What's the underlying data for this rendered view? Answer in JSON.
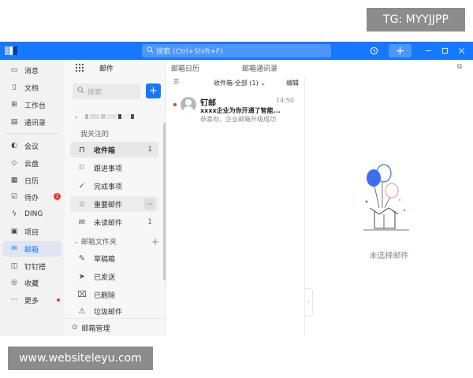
{
  "watermarks": {
    "top": "TG: MYYJJPP",
    "bottom": "www.websiteleyu.com"
  },
  "colors": {
    "accent": "#1677ff",
    "badge": "#f0353b",
    "nav_bg": "#f2f2f2",
    "active_bg": "#dfe5f2"
  },
  "titlebar": {
    "search_placeholder": "搜索 (Ctrl+Shift+F)",
    "icons": [
      "app-logo-icon",
      "search-icon",
      "history-icon",
      "plus-icon",
      "minimize-icon",
      "maximize-icon",
      "close-icon"
    ]
  },
  "nav": {
    "items": [
      {
        "label": "消息",
        "icon": "message-icon"
      },
      {
        "label": "文档",
        "icon": "document-icon"
      },
      {
        "label": "工作台",
        "icon": "workbench-icon"
      },
      {
        "label": "通讯录",
        "icon": "contacts-icon"
      },
      {
        "label": "会议",
        "icon": "meeting-icon"
      },
      {
        "label": "云盘",
        "icon": "cloud-drive-icon"
      },
      {
        "label": "日历",
        "icon": "calendar-icon"
      },
      {
        "label": "待办",
        "icon": "todo-icon",
        "badge": "1"
      },
      {
        "label": "DING",
        "icon": "ding-icon"
      },
      {
        "label": "项目",
        "icon": "project-icon"
      },
      {
        "label": "邮箱",
        "icon": "mail-icon",
        "active": true
      },
      {
        "label": "钉钉搭",
        "icon": "builder-icon"
      },
      {
        "label": "收藏",
        "icon": "favorites-icon"
      },
      {
        "label": "更多",
        "icon": "more-icon",
        "dot": true
      }
    ]
  },
  "folders": {
    "header_title": "邮件",
    "search_placeholder": "搜索",
    "followed_label": "我关注的",
    "items": [
      {
        "label": "收件箱",
        "icon": "inbox-icon",
        "count": "1",
        "selected": true
      },
      {
        "label": "跟进事项",
        "icon": "flag-icon"
      },
      {
        "label": "完成事项",
        "icon": "check-circle-icon"
      },
      {
        "label": "重要邮件",
        "icon": "star-icon",
        "more": "···"
      },
      {
        "label": "未读邮件",
        "icon": "envelope-icon",
        "count": "1"
      }
    ],
    "mailbox_folders_label": "邮箱文件夹",
    "mailbox_folders": [
      {
        "label": "草稿箱",
        "icon": "draft-icon"
      },
      {
        "label": "已发送",
        "icon": "send-icon"
      },
      {
        "label": "已删除",
        "icon": "trash-icon"
      },
      {
        "label": "垃圾邮件",
        "icon": "spam-icon"
      }
    ],
    "footer": "邮箱管理"
  },
  "tabs": [
    "邮箱日历",
    "邮箱通讯录"
  ],
  "list": {
    "filter": "收件箱-全部 (1)",
    "edit": "编辑",
    "mails": [
      {
        "sender": "钉邮",
        "time": "14:50",
        "subject": "xxxx企业为你开通了智能...",
        "preview": "恭喜你，企业邮箱升级成功"
      }
    ]
  },
  "reading": {
    "empty": "未选择邮件"
  }
}
